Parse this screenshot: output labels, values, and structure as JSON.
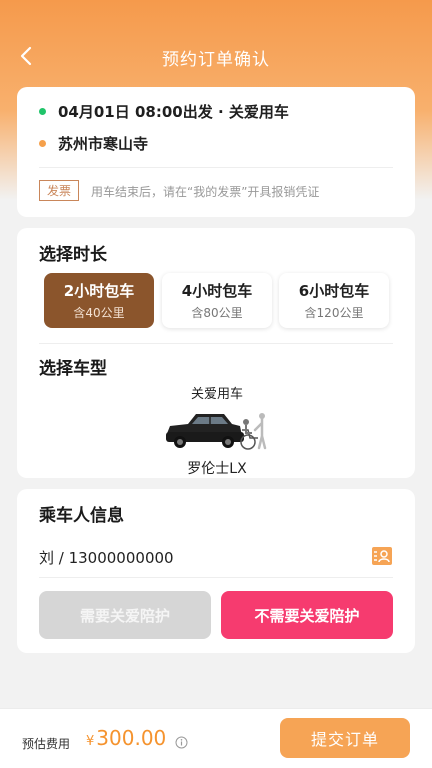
{
  "header": {
    "title": "预约订单确认"
  },
  "trip": {
    "start": "04月01日 08:00出发 · 关爱用车",
    "destination": "苏州市寒山寺",
    "invoice_tag": "发票",
    "invoice_tip": "用车结束后，请在“我的发票”开具报销凭证"
  },
  "duration": {
    "title": "选择时长",
    "options": [
      {
        "label": "2小时包车",
        "sub": "含40公里"
      },
      {
        "label": "4小时包车",
        "sub": "含80公里"
      },
      {
        "label": "6小时包车",
        "sub": "含120公里"
      }
    ],
    "selected_index": 0
  },
  "vehicle": {
    "title": "选择车型",
    "category": "关爱用车",
    "model": "罗伦士LX"
  },
  "passenger": {
    "title": "乘车人信息",
    "info": "刘 / 13000000000",
    "need_care_label": "需要关爱陪护",
    "no_care_label": "不需要关爱陪护"
  },
  "footer": {
    "fee_label": "预估费用",
    "currency": "¥",
    "amount": "300.00",
    "submit_label": "提交订单"
  },
  "colors": {
    "accent_orange": "#f5932e",
    "selected_brown": "#8b552c",
    "pink": "#f63b6f",
    "start_dot": "#20c46a",
    "end_dot": "#f5a04b"
  },
  "icons": {
    "back": "chevron-left-icon",
    "contact": "contact-book-icon",
    "info": "info-circle-icon"
  }
}
